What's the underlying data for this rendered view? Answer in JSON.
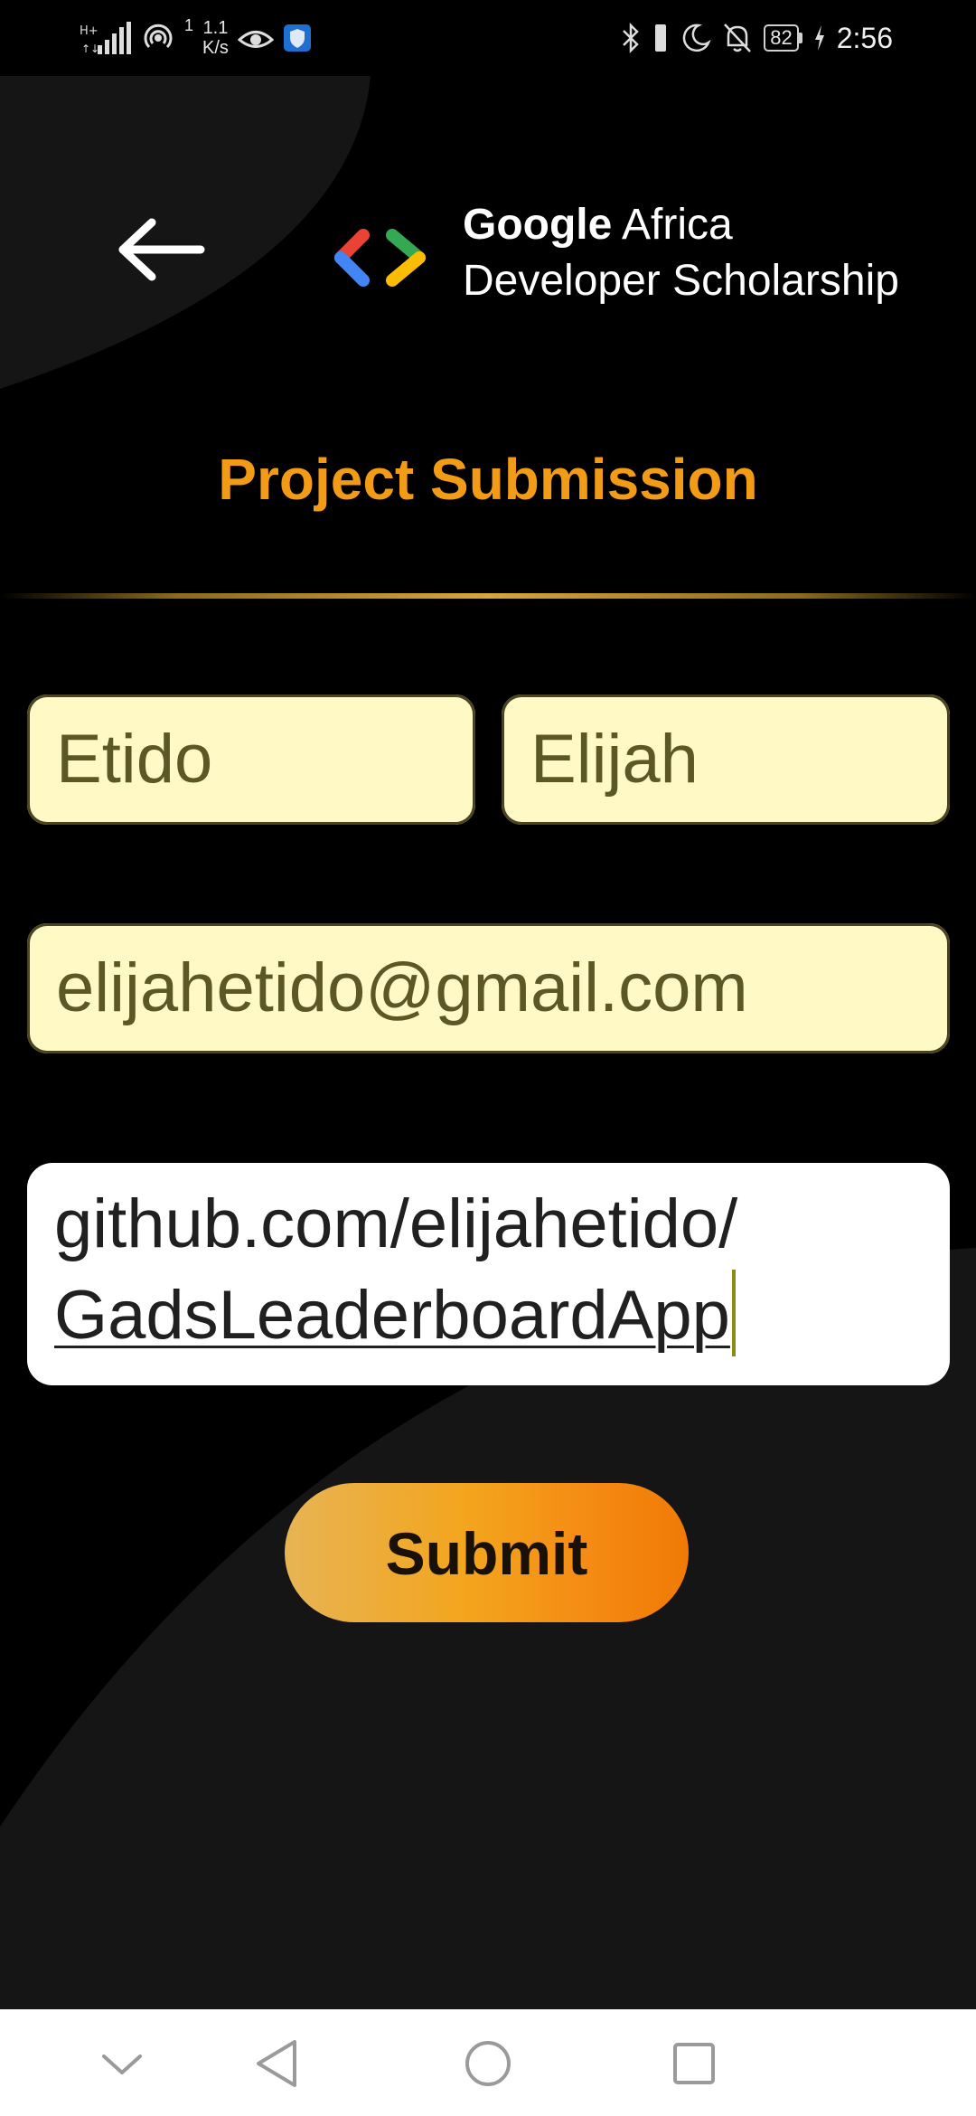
{
  "status_bar": {
    "signal_sup": "1",
    "net_speed_value": "1.1",
    "net_speed_unit": "K/s",
    "battery": "82",
    "time": "2:56"
  },
  "header": {
    "logo_google": "Google",
    "logo_africa": "Africa",
    "logo_subtitle": "Developer Scholarship"
  },
  "page_title": "Project Submission",
  "form": {
    "first_name": "Etido",
    "last_name": "Elijah",
    "email": "elijahetido@gmail.com",
    "github_line1": "github.com/elijahetido/",
    "github_line2": "GadsLeaderboardApp"
  },
  "submit_label": "Submit",
  "colors": {
    "title": "#f29b17",
    "field_background": "#fef9c5",
    "field_text": "#5c5826",
    "submit_gradient_start": "#e7b454",
    "submit_gradient_end": "#f07a05"
  }
}
